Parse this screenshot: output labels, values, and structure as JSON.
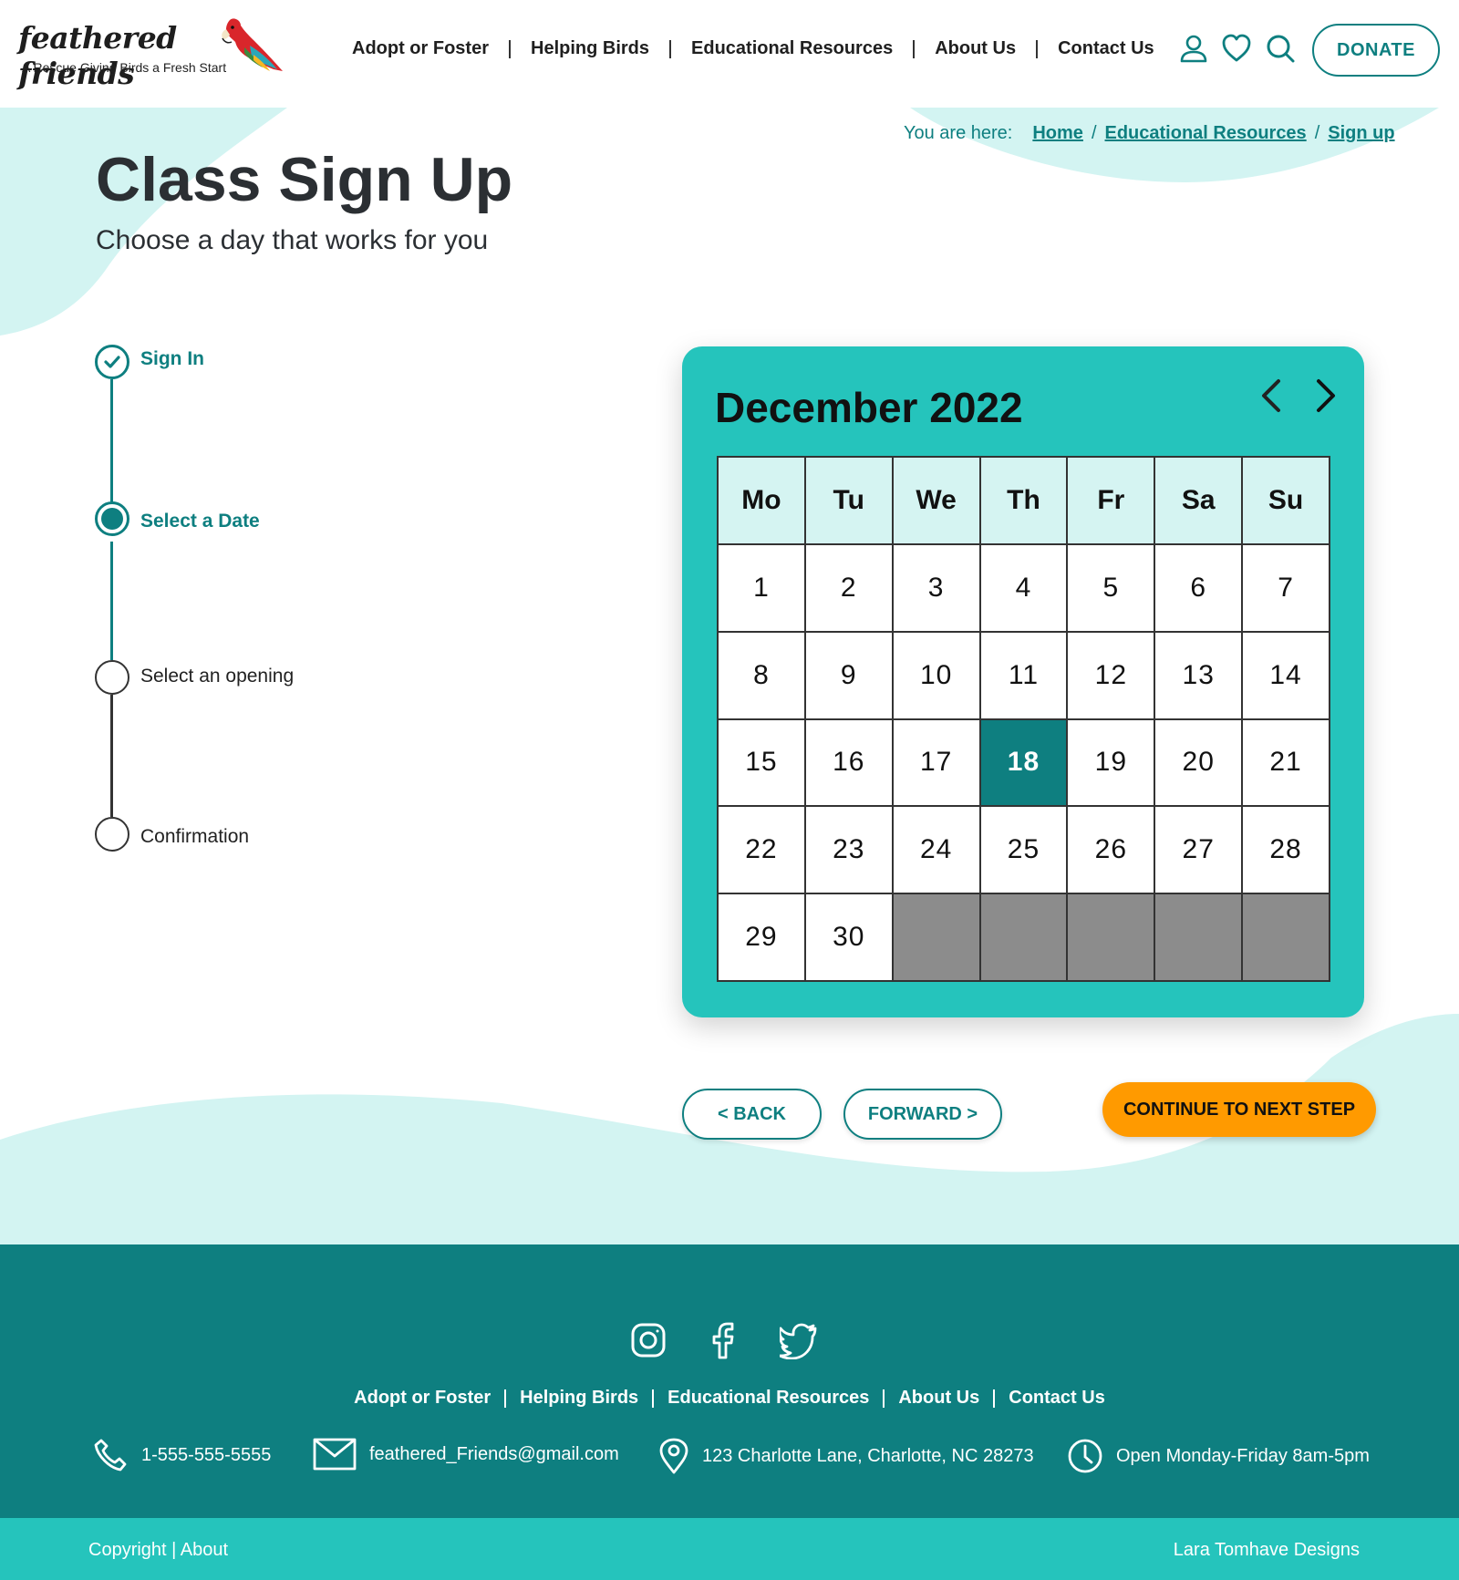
{
  "brand": {
    "name": "feathered friends",
    "tagline": "A Rescue Giving Birds a Fresh Start"
  },
  "header": {
    "nav": [
      "Adopt or Foster",
      "Helping Birds",
      "Educational Resources",
      "About Us",
      "Contact Us"
    ],
    "icons": [
      "user-icon",
      "heart-icon",
      "search-icon"
    ],
    "donate_label": "DONATE"
  },
  "breadcrumb": {
    "label": "You are here:",
    "items": [
      "Home",
      "Educational Resources",
      "Sign up"
    ]
  },
  "page": {
    "title": "Class Sign Up",
    "subtitle": "Choose a day that works for you"
  },
  "stepper": {
    "steps": [
      {
        "label": "Sign In",
        "state": "complete"
      },
      {
        "label": "Select a Date",
        "state": "current"
      },
      {
        "label": "Select an opening",
        "state": "pending"
      },
      {
        "label": "Confirmation",
        "state": "pending"
      }
    ]
  },
  "calendar": {
    "month_label": "December 2022",
    "weekdays": [
      "Mo",
      "Tu",
      "We",
      "Th",
      "Fr",
      "Sa",
      "Su"
    ],
    "days": [
      1,
      2,
      3,
      4,
      5,
      6,
      7,
      8,
      9,
      10,
      11,
      12,
      13,
      14,
      15,
      16,
      17,
      18,
      19,
      20,
      21,
      22,
      23,
      24,
      25,
      26,
      27,
      28,
      29,
      30
    ],
    "trailing_empty": 5,
    "selected_day": 18,
    "prev_icon": "chevron-left-icon",
    "next_icon": "chevron-right-icon"
  },
  "actions": {
    "back_label": "< BACK",
    "forward_label": "FORWARD >",
    "continue_label": "CONTINUE TO NEXT STEP"
  },
  "footer": {
    "social": [
      "instagram-icon",
      "facebook-icon",
      "twitter-icon"
    ],
    "nav": [
      "Adopt or Foster",
      "Helping Birds",
      "Educational Resources",
      "About Us",
      "Contact Us"
    ],
    "phone": "1-555-555-5555",
    "email": "feathered_Friends@gmail.com",
    "address": "123 Charlotte Lane, Charlotte, NC 28273",
    "hours": "Open Monday-Friday 8am-5pm",
    "copyright": "Copyright | About",
    "credit": "Lara Tomhave Designs"
  },
  "colors": {
    "teal_dark": "#0e7f80",
    "teal_bright": "#25c4bc",
    "teal_light": "#d3f4f2",
    "orange": "#ff9a00",
    "unavailable_gray": "#8c8c8c"
  }
}
